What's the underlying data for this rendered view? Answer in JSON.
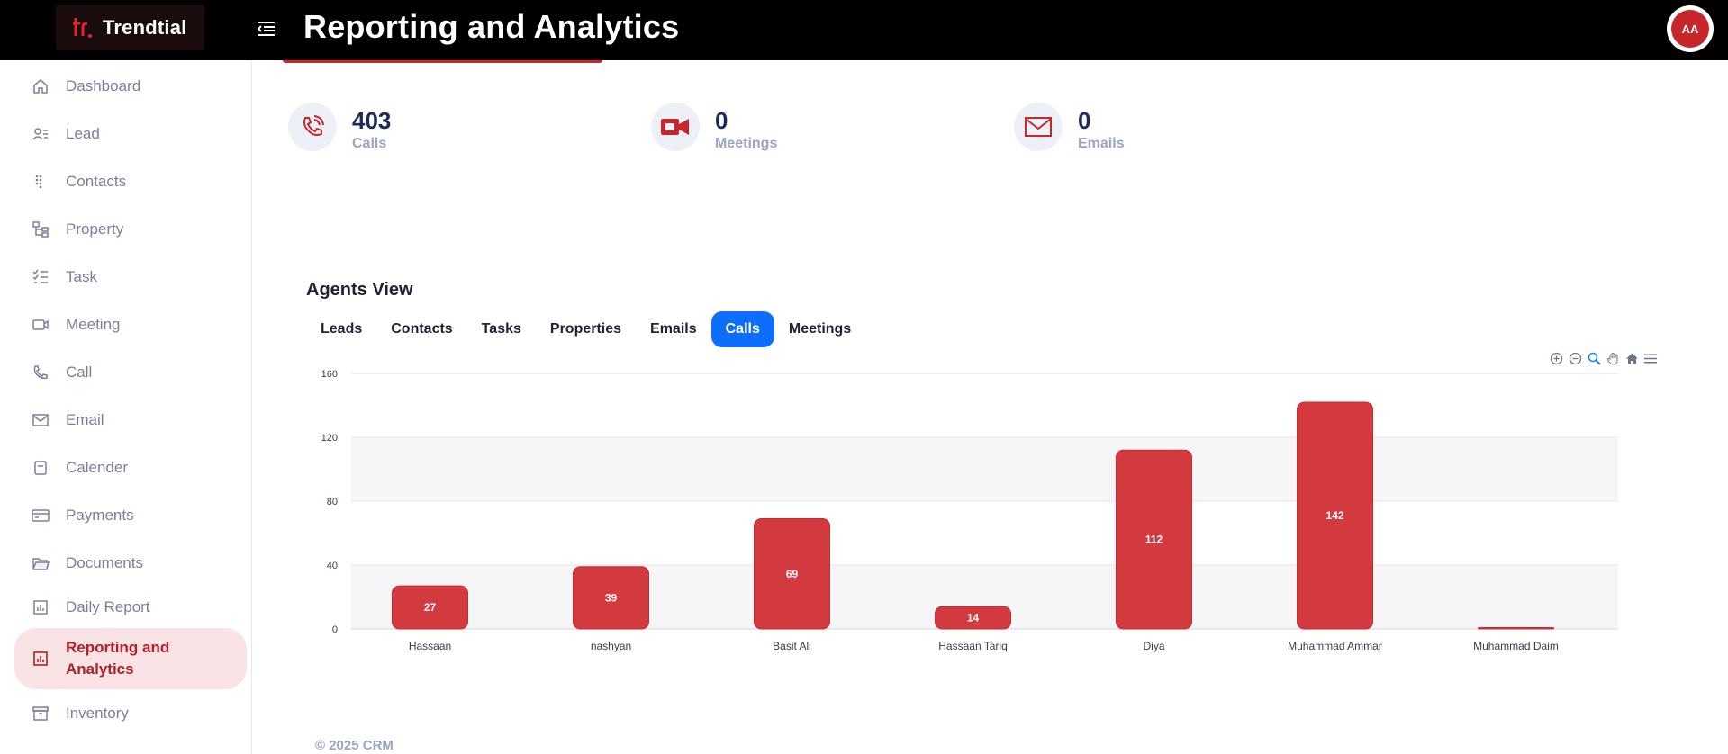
{
  "header": {
    "brand_name": "Trendtial",
    "title": "Reporting and Analytics",
    "avatar_initials": "AA"
  },
  "sidebar": {
    "items": [
      {
        "label": "Dashboard",
        "icon": "home-icon"
      },
      {
        "label": "Lead",
        "icon": "lead-icon"
      },
      {
        "label": "Contacts",
        "icon": "contacts-icon"
      },
      {
        "label": "Property",
        "icon": "property-icon"
      },
      {
        "label": "Task",
        "icon": "task-icon"
      },
      {
        "label": "Meeting",
        "icon": "meeting-icon"
      },
      {
        "label": "Call",
        "icon": "call-icon"
      },
      {
        "label": "Email",
        "icon": "email-icon"
      },
      {
        "label": "Calender",
        "icon": "calendar-icon"
      },
      {
        "label": "Payments",
        "icon": "payments-icon"
      },
      {
        "label": "Documents",
        "icon": "folder-icon"
      },
      {
        "label": "Daily Report",
        "icon": "daily-report-icon"
      },
      {
        "label": "Reporting and Analytics",
        "icon": "analytics-icon",
        "active": true
      },
      {
        "label": "Inventory",
        "icon": "inventory-icon"
      }
    ]
  },
  "stats": [
    {
      "value": "403",
      "label": "Calls",
      "icon": "phone-icon"
    },
    {
      "value": "0",
      "label": "Meetings",
      "icon": "video-icon"
    },
    {
      "value": "0",
      "label": "Emails",
      "icon": "mail-icon"
    }
  ],
  "agents_view": {
    "title": "Agents View",
    "tabs": [
      "Leads",
      "Contacts",
      "Tasks",
      "Properties",
      "Emails",
      "Calls",
      "Meetings"
    ],
    "active_tab": "Calls"
  },
  "chart_tools": [
    "zoom-in-icon",
    "zoom-out-icon",
    "selection-zoom-icon",
    "pan-icon",
    "reset-home-icon",
    "menu-icon"
  ],
  "chart_data": {
    "type": "bar",
    "categories": [
      "Hassaan",
      "nashyan",
      "Basit Ali",
      "Hassaan Tariq",
      "Diya",
      "Muhammad Ammar",
      "Muhammad Daim"
    ],
    "values": [
      27,
      39,
      69,
      14,
      112,
      142,
      0
    ],
    "data_labels": [
      "27",
      "39",
      "69",
      "14",
      "112",
      "142",
      ""
    ],
    "yticks": [
      0,
      40,
      80,
      120,
      160
    ],
    "ylim": [
      0,
      160
    ],
    "bar_color": "#d23a3f",
    "grid": true
  },
  "footer": {
    "text": "© 2025 CRM"
  },
  "colors": {
    "accent": "#c9262c",
    "primary_tab": "#0d6efd",
    "active_nav_bg": "#f9e3e4"
  }
}
